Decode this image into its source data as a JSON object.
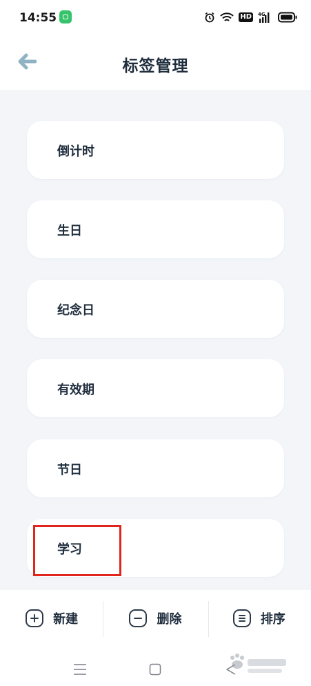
{
  "status_bar": {
    "time": "14:55",
    "network_label": "4G",
    "hd_label": "HD"
  },
  "header": {
    "title": "标签管理"
  },
  "tags": [
    {
      "label": "倒计时"
    },
    {
      "label": "生日"
    },
    {
      "label": "纪念日"
    },
    {
      "label": "有效期"
    },
    {
      "label": "节日"
    },
    {
      "label": "学习"
    }
  ],
  "toolbar": {
    "new_label": "新建",
    "delete_label": "删除",
    "sort_label": "排序"
  },
  "colors": {
    "background": "#f3f5f9",
    "card": "#ffffff",
    "text": "#1f2d3d",
    "back_arrow": "#8fb3c4",
    "highlight": "#e0261c",
    "notif_icon": "#35c46b"
  },
  "icons": {
    "back": "arrow-left-icon",
    "new": "plus-icon",
    "delete": "minus-icon",
    "sort": "list-icon"
  }
}
